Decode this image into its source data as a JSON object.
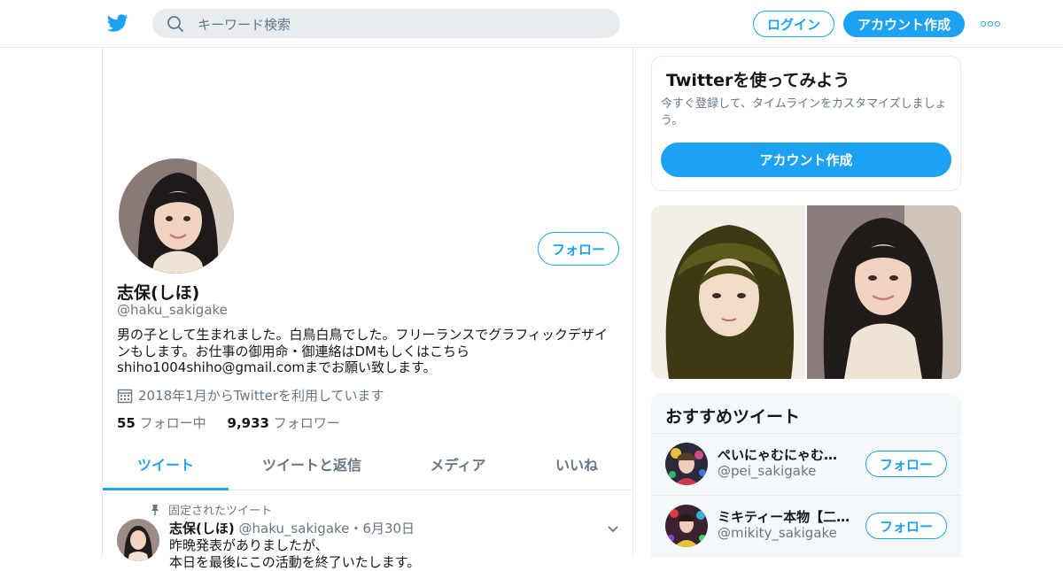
{
  "topbar": {
    "search_placeholder": "キーワード検索",
    "login_label": "ログイン",
    "signup_label": "アカウント作成"
  },
  "profile": {
    "follow_label": "フォロー",
    "name": "志保(しほ)",
    "handle": "@haku_sakigake",
    "bio": "男の子として生まれました。白鳥白鳥でした。フリーランスでグラフィックデザイ\nンもします。お仕事の御用命・御連絡はDMもしくはこちら\nshiho1004shiho@gmail.comまでお願い致します。",
    "joined": "2018年1月からTwitterを利用しています",
    "following_count": "55",
    "following_label": "フォロー中",
    "followers_count": "9,933",
    "followers_label": "フォロワー"
  },
  "tabs": [
    {
      "label": "ツイート"
    },
    {
      "label": "ツイートと返信"
    },
    {
      "label": "メディア"
    },
    {
      "label": "いいね"
    }
  ],
  "tweet": {
    "pinned_label": "固定されたツイート",
    "author": "志保(しほ)",
    "handle": "@haku_sakigake",
    "dot": "・",
    "date": "6月30日",
    "text": "昨晩発表がありましたが、\n本日を最後にこの活動を終了いたします。"
  },
  "signup_card": {
    "title": "Twitterを使ってみよう",
    "desc": "今すぐ登録して、タイムラインをカスタマイズしましょう。",
    "button": "アカウント作成"
  },
  "recommend": {
    "title": "おすすめツイート",
    "items": [
      {
        "name": "ぺいにゃむにゃむ【二…",
        "handle": "@pei_sakigake",
        "follow": "フォロー"
      },
      {
        "name": "ミキティー本物【二…",
        "handle": "@mikity_sakigake",
        "follow": "フォロー"
      }
    ]
  },
  "colors": {
    "accent": "#1da1f2",
    "muted": "#657786",
    "border": "#e1e8ed"
  },
  "icons": [
    "twitter-bird-icon",
    "search-icon",
    "more-dots-icon",
    "calendar-icon",
    "pin-icon",
    "chevron-down-icon"
  ]
}
